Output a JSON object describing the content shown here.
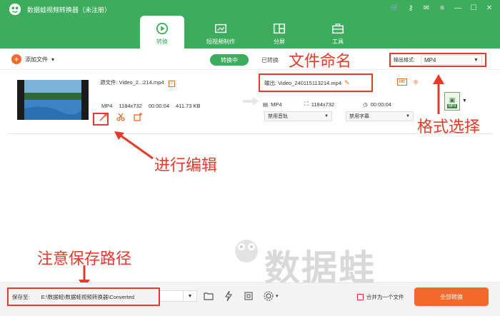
{
  "app": {
    "title": "数据蛙视频转换器（未注册）"
  },
  "tabs": [
    {
      "label": "转换"
    },
    {
      "label": "短视频制作"
    },
    {
      "label": "分屏"
    },
    {
      "label": "工具"
    }
  ],
  "toolbar": {
    "add_file": "添加文件",
    "converting": "转换中",
    "converted": "已转换",
    "output_format_label": "输出格式:",
    "output_format_value": "MP4"
  },
  "file": {
    "source_label": "源文件: Video_2...214.mp4",
    "format": "MP4",
    "resolution": "1184x732",
    "duration": "00:00:04",
    "size": "411.73 KB",
    "output_name": "输出: Video_240115113214.mp4",
    "out_format": "MP4",
    "out_resolution": "1184x732",
    "out_duration": "00:00:04",
    "audio": "禁用音轨",
    "subtitle": "禁用字幕",
    "hd_badge": "HD",
    "format_thumb": "MP4"
  },
  "annotations": {
    "file_naming": "文件命名",
    "format_select": "格式选择",
    "edit": "进行编辑",
    "save_path": "注意保存路径"
  },
  "bottom": {
    "save_label": "保存至:",
    "save_path": "E:\\数据蛙\\数据蛙视频转换器\\Converted",
    "merge_label": "合并为一个文件",
    "convert_all": "全部转换"
  },
  "watermark": {
    "text": "数据蛙",
    "url": "shuju"
  },
  "colors": {
    "brand": "#3dac5c",
    "accent": "#f26b2c",
    "annotation": "#e53b2a"
  }
}
